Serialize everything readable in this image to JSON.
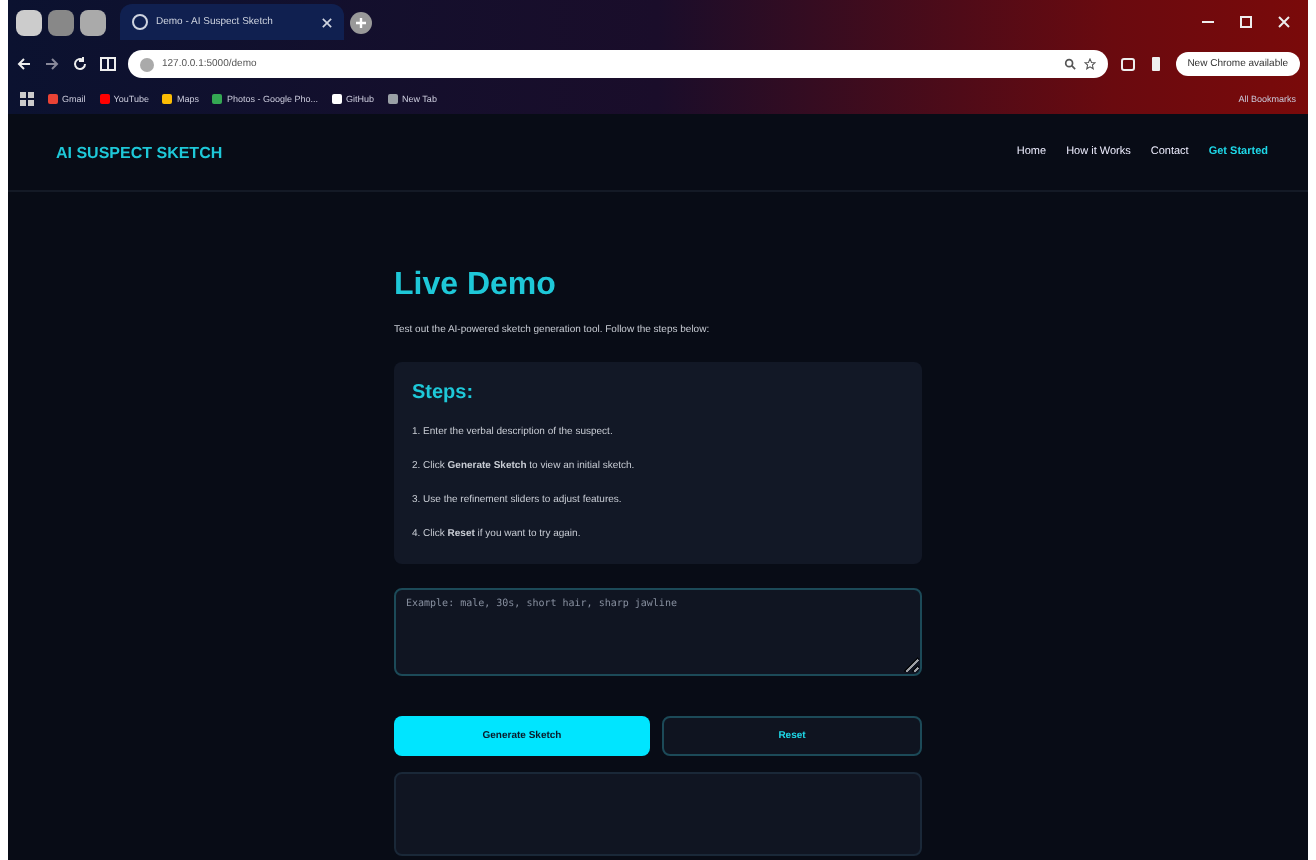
{
  "browser": {
    "tab_title": "Demo - AI Suspect Sketch",
    "url": "127.0.0.1:5000/demo",
    "update_badge": "New Chrome available",
    "bookmarks": [
      {
        "label": "Gmail",
        "color": "#ea4335"
      },
      {
        "label": "YouTube",
        "color": "#ff0000"
      },
      {
        "label": "Maps",
        "color": "#fbbc04"
      },
      {
        "label": "Photos - Google Pho...",
        "color": "#34a853"
      },
      {
        "label": "GitHub",
        "color": "#ffffff"
      },
      {
        "label": "New Tab",
        "color": "#9aa0a6"
      }
    ],
    "all_bookmarks": "All Bookmarks"
  },
  "navbar": {
    "logo": "AI SUSPECT SKETCH",
    "links": [
      {
        "label": "Home",
        "selected": false
      },
      {
        "label": "How it Works",
        "selected": false
      },
      {
        "label": "Contact",
        "selected": false
      },
      {
        "label": "Get Started",
        "selected": true
      }
    ]
  },
  "demo": {
    "title": "Live Demo",
    "intro": "Test out the AI-powered sketch generation tool. Follow the steps below:",
    "steps_title": "Steps:",
    "steps": [
      "1. Enter the verbal description of the suspect.",
      "2. Click **Generate Sketch** to view an initial sketch.",
      "3. Use the refinement sliders to adjust features.",
      "4. Click **Reset** if you want to try again."
    ],
    "description": {
      "placeholder": "Example: male, 30s, short hair, sharp jawline"
    },
    "buttons": [
      {
        "label": "Generate Sketch",
        "kind": "primary"
      },
      {
        "label": "Reset",
        "kind": "outline"
      }
    ]
  }
}
